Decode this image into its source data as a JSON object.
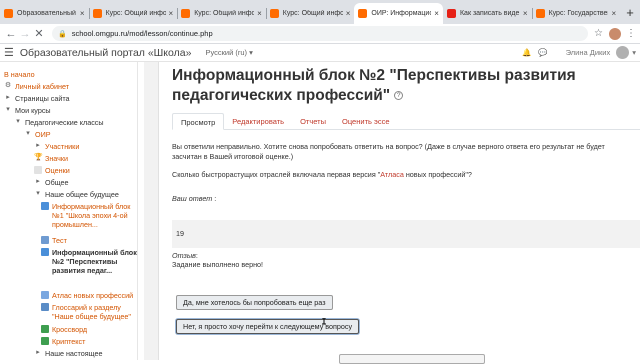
{
  "browser": {
    "tabs": [
      {
        "title": "Образовательный п",
        "favicon_color": "#ff6b00",
        "active": false
      },
      {
        "title": "Курс: Общий инфо",
        "favicon_color": "#ff6b00",
        "active": false
      },
      {
        "title": "Курс: Общий инфо",
        "favicon_color": "#ff6b00",
        "active": false
      },
      {
        "title": "Курс: Общий инфо",
        "favicon_color": "#ff6b00",
        "active": false
      },
      {
        "title": "ОИР: Информацион",
        "favicon_color": "#ff6b00",
        "active": true
      },
      {
        "title": "Как записать виде",
        "favicon_color": "#e62117",
        "active": false
      },
      {
        "title": "Курс: Государствен",
        "favicon_color": "#ff6b00",
        "active": false
      }
    ],
    "new_tab_icon": "+",
    "url": "school.omgpu.ru/mod/lesson/continue.php"
  },
  "navbar": {
    "site_name": "Образовательный портал «Школа»",
    "language": "Русский (ru)",
    "user_name": "Элина Диких"
  },
  "drawer": {
    "items": [
      {
        "label": "В начало",
        "type": "link"
      },
      {
        "label": "Личный кабинет",
        "type": "link"
      },
      {
        "label": "Страницы сайта",
        "type": "text"
      },
      {
        "label": "Мои курсы",
        "type": "text"
      },
      {
        "label": "Педагогические классы",
        "type": "text"
      },
      {
        "label": "ОИР",
        "type": "link"
      },
      {
        "label": "Участники",
        "type": "link"
      },
      {
        "label": "Значки",
        "type": "link"
      },
      {
        "label": "Оценки",
        "type": "link"
      },
      {
        "label": "Общее",
        "type": "text"
      },
      {
        "label": "Наше общее будущее",
        "type": "text"
      },
      {
        "label": "Информационный блок №1 \"Школа эпохи 4-ой промышлен...",
        "type": "link"
      },
      {
        "label": "Тест",
        "type": "link"
      },
      {
        "label": "Информационный блок №2 \"Перспективы развития педаг...",
        "type": "current"
      },
      {
        "label": "Атлас новых профессий",
        "type": "link"
      },
      {
        "label": "Глоссарий к разделу \"Наше общее будущее\"",
        "type": "link"
      },
      {
        "label": "Кроссворд",
        "type": "link"
      },
      {
        "label": "Криптекст",
        "type": "link"
      },
      {
        "label": "Наше настоящее",
        "type": "text"
      }
    ]
  },
  "main": {
    "title": "Информационный блок №2 \"Перспективы развития педагогических профессий\"",
    "tabs": [
      "Просмотр",
      "Редактировать",
      "Отчеты",
      "Оценить эссе"
    ],
    "wrong_msg": "Вы ответили неправильно. Хотите снова попробовать ответить на вопрос? (Даже в случае верного ответа его результат не будет засчитан в Вашей итоговой оценке.)",
    "question_prefix": "Сколько быстрорастущих отраслей включала первая версия \"",
    "question_highlight": "Атласа",
    "question_suffix": " новых профессий\"?",
    "answer_label": "Ваш ответ",
    "answer_colon": " :",
    "answer_value": "19",
    "feedback_label": "Отзыв",
    "feedback_colon": ":",
    "feedback_text": "Задание выполнено верно!",
    "btn_retry": "Да, мне хотелось бы попробовать еще раз",
    "btn_continue": "Нет, я просто хочу перейти к следующему вопросу"
  }
}
